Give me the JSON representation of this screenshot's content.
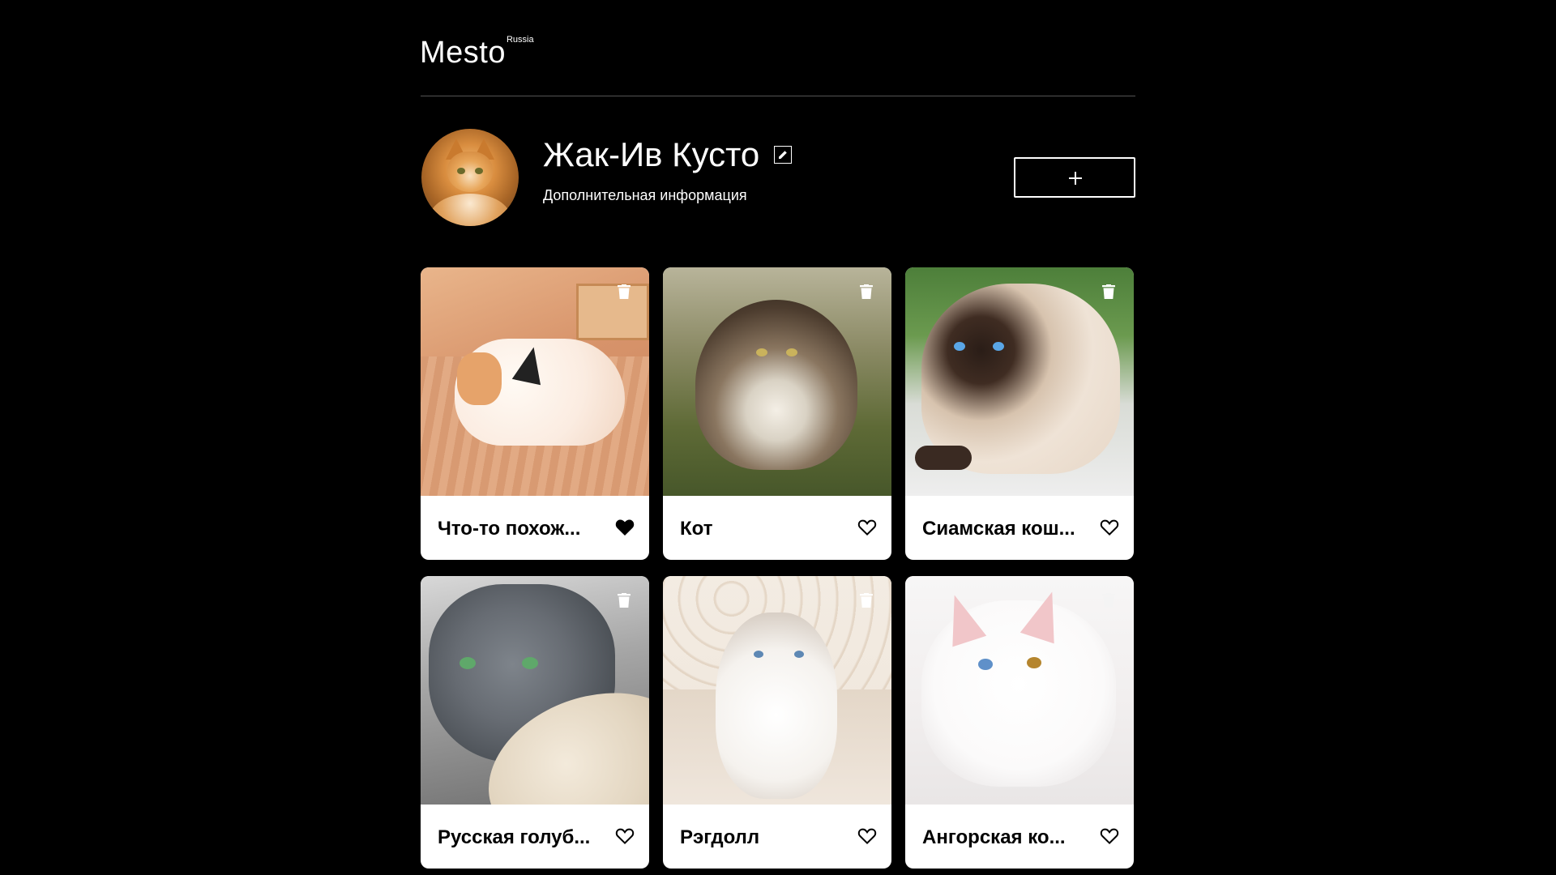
{
  "header": {
    "logo": "Mesto",
    "logo_superscript": "Russia"
  },
  "profile": {
    "name": "Жак-Ив Кусто",
    "about": "Дополнительная информация",
    "avatar_icon": "cat-avatar-photo",
    "edit_icon": "pencil-edit-icon",
    "add_button_icon": "plus-icon"
  },
  "cards": [
    {
      "title": "Что-то похож...",
      "liked": true,
      "photo": "plush-cat-toy-photo"
    },
    {
      "title": "Кот",
      "liked": false,
      "photo": "fluffy-tabby-cat-photo"
    },
    {
      "title": "Сиамская кош...",
      "liked": false,
      "photo": "siamese-cat-photo"
    },
    {
      "title": "Русская голуб...",
      "liked": false,
      "photo": "russian-blue-cat-photo"
    },
    {
      "title": "Рэгдолл",
      "liked": false,
      "photo": "ragdoll-cat-photo"
    },
    {
      "title": "Ангорская ко...",
      "liked": false,
      "photo": "angora-cat-photo"
    }
  ],
  "colors": {
    "background": "#000000",
    "card_background": "#ffffff",
    "divider": "#545454"
  }
}
